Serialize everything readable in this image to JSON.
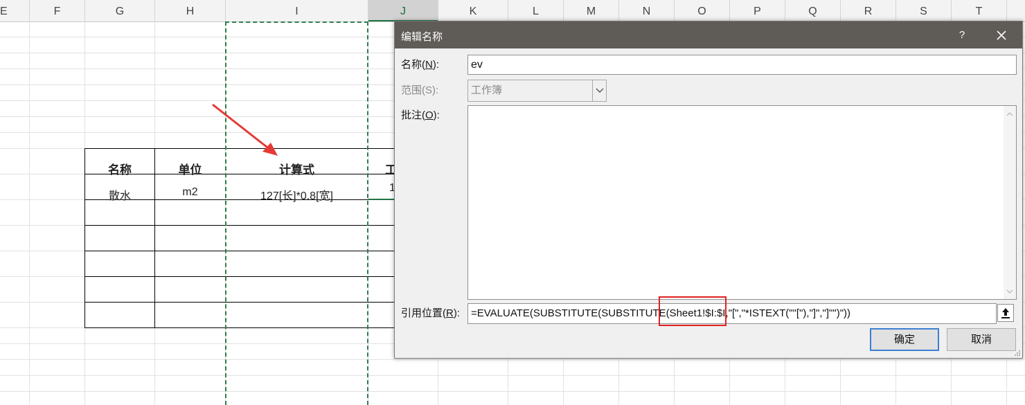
{
  "sheet": {
    "columns": [
      "E",
      "F",
      "G",
      "H",
      "I",
      "J",
      "K",
      "L",
      "M",
      "N",
      "O",
      "P",
      "Q",
      "R",
      "S",
      "T"
    ],
    "headers": [
      "名称",
      "单位",
      "计算式",
      "工"
    ],
    "row1": [
      "散水",
      "m2",
      "127[长]*0.8[宽]",
      "1"
    ]
  },
  "dialog": {
    "title": "编辑名称",
    "help": "?",
    "name_label_prefix": "名称(",
    "name_label_key": "N",
    "name_label_suffix": "):",
    "name_value": "ev",
    "scope_label": "范围(S):",
    "scope_value": "工作簿",
    "comment_label_prefix": "批注(",
    "comment_label_key": "O",
    "comment_label_suffix": "):",
    "comment_value": "",
    "ref_label_prefix": "引用位置(",
    "ref_label_key": "R",
    "ref_label_suffix": "):",
    "ref_value": "=EVALUATE(SUBSTITUTE(SUBSTITUTE(Sheet1!$I:$I,\"[\",\"*ISTEXT(\"\"[\"),\"]\",\"]\"\")\"))",
    "ok": "确定",
    "cancel": "取消"
  },
  "colors": {
    "titlebar": "#5f5b57",
    "accent_green": "#217346",
    "highlight_red": "#e02020",
    "arrow_red": "#e53935"
  }
}
